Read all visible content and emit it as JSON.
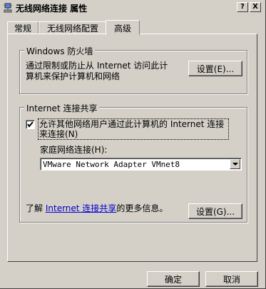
{
  "window": {
    "title": "无线网络连接 属性",
    "help_glyph": "?",
    "close_glyph": "X"
  },
  "tabs": [
    {
      "label": "常规"
    },
    {
      "label": "无线网络配置"
    },
    {
      "label": "高级"
    }
  ],
  "firewall": {
    "group_label": "Windows 防火墙",
    "description_line1": "通过限制或防止从 Internet 访问此计",
    "description_line2": "算机来保护计算机和网络",
    "settings_button": "设置(E)..."
  },
  "ics": {
    "group_label": "Internet 连接共享",
    "allow_checkbox_line1": "允许其他网络用户通过此计算机的 Internet 连接",
    "allow_checkbox_line2": "来连接(N)",
    "allow_checked": true,
    "home_network_label": "家庭网络连接(H):",
    "home_network_value": "VMware Network Adapter VMnet8",
    "learn_prefix": "了解",
    "learn_link": "Internet 连接共享",
    "learn_suffix": "的更多信息。",
    "settings_button": "设置(G)..."
  },
  "footer": {
    "ok_button": "确定",
    "cancel_button": "取消"
  },
  "colors": {
    "face": "#d4d0c8",
    "link": "#0000cc"
  },
  "icons": {
    "title": "network-connection-icon",
    "dropdown": "chevron-down-icon",
    "check": "checkmark-icon"
  }
}
